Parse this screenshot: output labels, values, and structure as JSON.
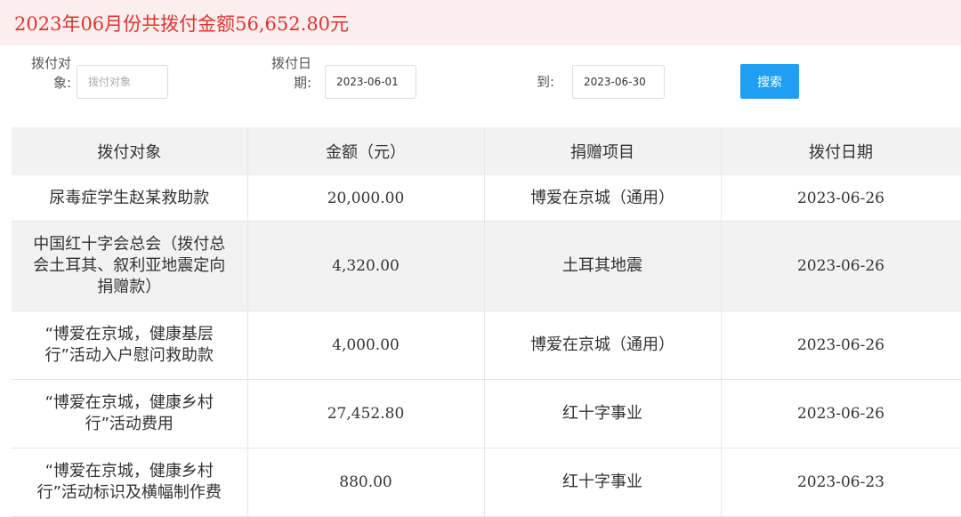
{
  "banner": {
    "text": "2023年06月份共拨付金额56,652.80元"
  },
  "filters": {
    "target_label_line1": "拨付对",
    "target_label_line2": "象:",
    "target_placeholder": "拨付对象",
    "date_label_line1": "拨付日",
    "date_label_line2": "期:",
    "date_from": "2023-06-01",
    "to_label": "到:",
    "date_to": "2023-06-30",
    "search_label": "搜索"
  },
  "table": {
    "headers": [
      "拨付对象",
      "金额（元）",
      "捐赠项目",
      "拨付日期"
    ],
    "rows": [
      {
        "target": "尿毒症学生赵某救助款",
        "amount": "20,000.00",
        "project": "博爱在京城（通用）",
        "date": "2023-06-26"
      },
      {
        "target": "中国红十字会总会（拨付总会土耳其、叙利亚地震定向捐赠款）",
        "amount": "4,320.00",
        "project": "土耳其地震",
        "date": "2023-06-26"
      },
      {
        "target": "“博爱在京城，健康基层行”活动入户慰问救助款",
        "amount": "4,000.00",
        "project": "博爱在京城（通用）",
        "date": "2023-06-26"
      },
      {
        "target": "“博爱在京城，健康乡村行”活动费用",
        "amount": "27,452.80",
        "project": "红十字事业",
        "date": "2023-06-26"
      },
      {
        "target": "“博爱在京城，健康乡村行”活动标识及横幅制作费",
        "amount": "880.00",
        "project": "红十字事业",
        "date": "2023-06-23"
      }
    ]
  },
  "colors": {
    "banner_bg": "#fbeeee",
    "banner_text": "#e0342f",
    "button": "#1e9ff2",
    "header_bg": "#f2f2f2"
  }
}
